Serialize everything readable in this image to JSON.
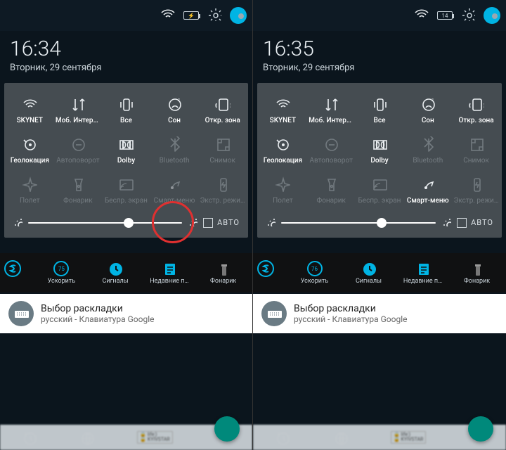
{
  "panels": [
    {
      "time": "16:34",
      "date": "Вторник, 29 сентября",
      "batteryText": "⚡",
      "circle": true,
      "brightnessPos": 62,
      "smartMenuOn": false
    },
    {
      "time": "16:35",
      "date": "Вторник, 29 сентября",
      "batteryText": "14",
      "circle": false,
      "brightnessPos": 62,
      "smartMenuOn": true
    }
  ],
  "tiles": [
    [
      {
        "id": "wifi",
        "label": "SKYNET",
        "on": true
      },
      {
        "id": "data",
        "label": "Моб. Интернет",
        "on": true
      },
      {
        "id": "vibrate",
        "label": "Все",
        "on": true
      },
      {
        "id": "dnd",
        "label": "Сон",
        "on": true
      },
      {
        "id": "hotspot",
        "label": "Откр. зона",
        "on": true
      }
    ],
    [
      {
        "id": "location",
        "label": "Геолокация",
        "on": true
      },
      {
        "id": "rotate",
        "label": "Автоповорот",
        "on": false
      },
      {
        "id": "dolby",
        "label": "Dolby",
        "on": true
      },
      {
        "id": "bluetooth",
        "label": "Bluetooth",
        "on": false
      },
      {
        "id": "screenshot",
        "label": "Снимок",
        "on": false
      }
    ],
    [
      {
        "id": "airplane",
        "label": "Полет",
        "on": false
      },
      {
        "id": "flashlight",
        "label": "Фонарик",
        "on": false
      },
      {
        "id": "cast",
        "label": "Беспр. экран",
        "on": false
      },
      {
        "id": "smartmenu",
        "label": "Смарт-меню"
      },
      {
        "id": "power",
        "label": "Экстр. режим",
        "on": false
      }
    ]
  ],
  "brightnessAutoLabel": "АВТО",
  "toolbar": [
    {
      "id": "boost",
      "label": "Ускорить",
      "badge": [
        "75",
        "76"
      ]
    },
    {
      "id": "alarms",
      "label": "Сигналы"
    },
    {
      "id": "recent",
      "label": "Недавние п…"
    },
    {
      "id": "torch",
      "label": "Фонарик"
    }
  ],
  "notification": {
    "title": "Выбор раскладки",
    "subtitle": "русский - Клавиатура Google"
  },
  "bottomTabs": {
    "tab1": "life:)",
    "tab2": "KYIVSTAR"
  },
  "colors": {
    "accent": "#00b4e4",
    "panel": "#454c51",
    "dark": "#0b151d"
  }
}
